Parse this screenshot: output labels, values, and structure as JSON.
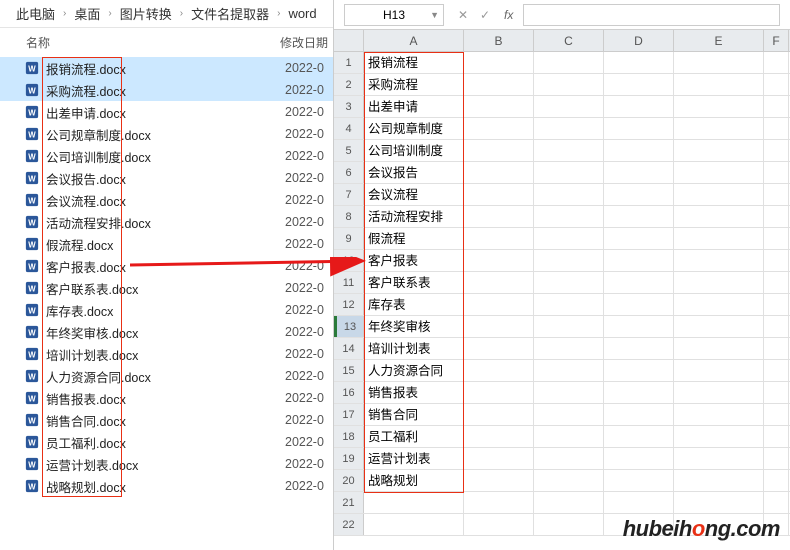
{
  "breadcrumb": [
    "此电脑",
    "桌面",
    "图片转换",
    "文件名提取器",
    "word"
  ],
  "explorer": {
    "columns": {
      "name": "名称",
      "date": "修改日期"
    },
    "files": [
      {
        "name": "报销流程.docx",
        "date": "2022-0"
      },
      {
        "name": "采购流程.docx",
        "date": "2022-0"
      },
      {
        "name": "出差申请.docx",
        "date": "2022-0"
      },
      {
        "name": "公司规章制度.docx",
        "date": "2022-0"
      },
      {
        "name": "公司培训制度.docx",
        "date": "2022-0"
      },
      {
        "name": "会议报告.docx",
        "date": "2022-0"
      },
      {
        "name": "会议流程.docx",
        "date": "2022-0"
      },
      {
        "name": "活动流程安排.docx",
        "date": "2022-0"
      },
      {
        "name": "假流程.docx",
        "date": "2022-0"
      },
      {
        "name": "客户报表.docx",
        "date": "2022-0"
      },
      {
        "name": "客户联系表.docx",
        "date": "2022-0"
      },
      {
        "name": "库存表.docx",
        "date": "2022-0"
      },
      {
        "name": "年终奖审核.docx",
        "date": "2022-0"
      },
      {
        "name": "培训计划表.docx",
        "date": "2022-0"
      },
      {
        "name": "人力资源合同.docx",
        "date": "2022-0"
      },
      {
        "name": "销售报表.docx",
        "date": "2022-0"
      },
      {
        "name": "销售合同.docx",
        "date": "2022-0"
      },
      {
        "name": "员工福利.docx",
        "date": "2022-0"
      },
      {
        "name": "运营计划表.docx",
        "date": "2022-0"
      },
      {
        "name": "战略规划.docx",
        "date": "2022-0"
      }
    ]
  },
  "spreadsheet": {
    "namebox": "H13",
    "fx": "fx",
    "columns": [
      "A",
      "B",
      "C",
      "D",
      "E",
      "F"
    ],
    "rows": [
      "报销流程",
      "采购流程",
      "出差申请",
      "公司规章制度",
      "公司培训制度",
      "会议报告",
      "会议流程",
      "活动流程安排",
      "假流程",
      "客户报表",
      "客户联系表",
      "库存表",
      "年终奖审核",
      "培训计划表",
      "人力资源合同",
      "销售报表",
      "销售合同",
      "员工福利",
      "运营计划表",
      "战略规划",
      "",
      ""
    ],
    "selected_row_head": 13
  },
  "watermark": {
    "pre": "hubeih",
    "o": "o",
    "post": "ng.com"
  }
}
